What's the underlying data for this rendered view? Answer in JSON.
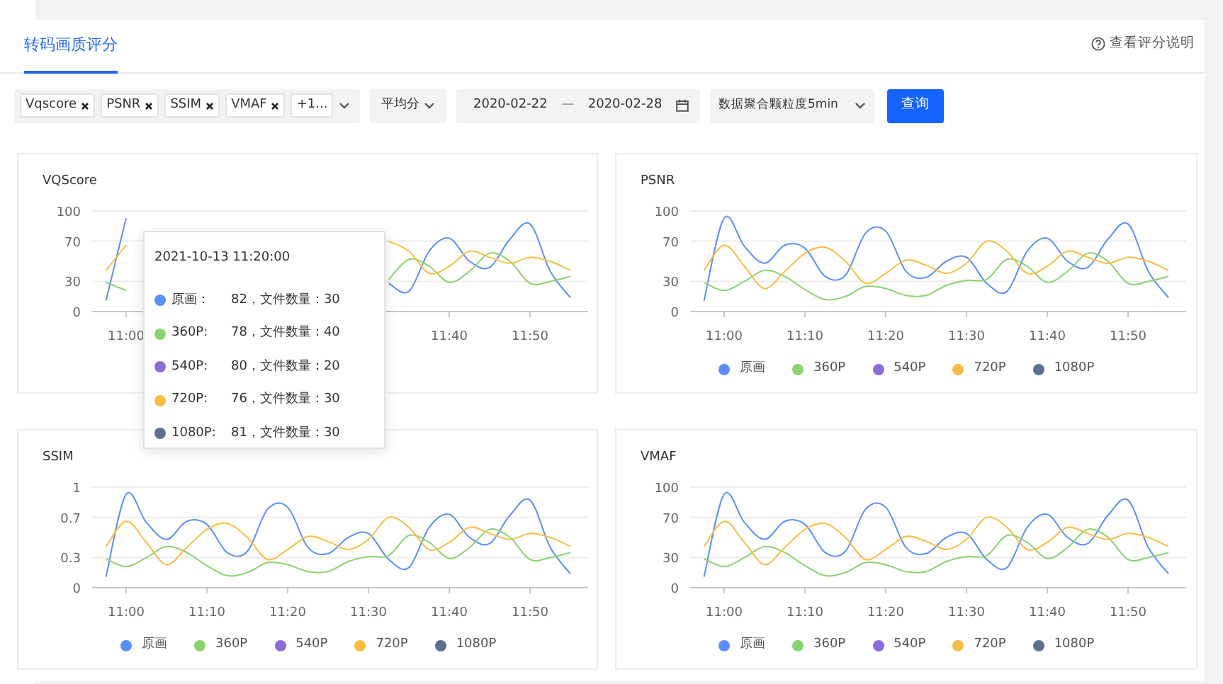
{
  "header": {
    "tab": {
      "label": "转码画质评分",
      "selected": true
    },
    "help_link": "查看评分说明"
  },
  "filters": {
    "metrics": {
      "tags": [
        "Vqscore",
        "PSNR",
        "SSIM",
        "VMAF"
      ],
      "more": "+1..."
    },
    "aggregate": "平均分",
    "date_from": "2020-02-22",
    "date_sep": "—",
    "date_to": "2020-02-28",
    "granularity": "数据聚合颗粒度5min",
    "query_button": "查询"
  },
  "panels": [
    {
      "chart_data": {
        "type": "line",
        "title": "VQScore",
        "categories": [
          null,
          "11:00",
          null,
          null,
          null,
          null,
          null,
          null,
          null,
          null,
          null,
          null,
          null,
          null,
          null,
          null,
          null,
          "11:40",
          null,
          null,
          null,
          "11:50",
          null,
          null
        ],
        "ylim": [
          0,
          100
        ],
        "yticks": [
          0,
          30,
          70,
          100
        ],
        "series": [
          {
            "color": "#5b8ff9",
            "values": [
              11,
              93,
              null,
              null,
              null,
              null,
              null,
              null,
              null,
              null,
              null,
              null,
              null,
              null,
              28,
              20,
              60,
              73,
              50,
              44,
              72,
              87,
              40,
              14
            ]
          },
          {
            "color": "#8ad36f",
            "values": [
              29,
              21,
              null,
              null,
              null,
              null,
              null,
              null,
              null,
              null,
              null,
              null,
              null,
              null,
              32,
              52,
              45,
              29,
              40,
              58,
              50,
              28,
              30,
              35
            ]
          },
          {
            "color": "#f6bd45",
            "values": [
              41,
              66,
              null,
              null,
              null,
              null,
              null,
              null,
              null,
              null,
              null,
              null,
              null,
              null,
              70,
              60,
              38,
              45,
              60,
              54,
              48,
              54,
              50,
              41
            ]
          }
        ]
      },
      "tooltip": {
        "title": "2021-10-13 11:20:00",
        "rows": [
          {
            "label": "原画：",
            "value": "82，文件数量：30",
            "color": "#5b8ff9"
          },
          {
            "label": "360P:",
            "value": "78，文件数量：40",
            "color": "#8ad36f"
          },
          {
            "label": "540P:",
            "value": "80，文件数量：20",
            "color": "#8e6bd8"
          },
          {
            "label": "720P:",
            "value": "76，文件数量：30",
            "color": "#f6bd45"
          },
          {
            "label": "1080P:",
            "value": "81，文件数量：30",
            "color": "#5d7092"
          }
        ]
      }
    },
    {
      "chart_data": {
        "type": "line",
        "title": "PSNR",
        "categories": [
          null,
          "11:00",
          null,
          null,
          null,
          "11:10",
          null,
          null,
          null,
          "11:20",
          null,
          null,
          null,
          "11:30",
          null,
          null,
          null,
          "11:40",
          null,
          null,
          null,
          "11:50",
          null,
          null
        ],
        "ylim": [
          0,
          100
        ],
        "yticks": [
          0,
          30,
          70,
          100
        ],
        "series": [
          {
            "name": "原画",
            "color": "#5b8ff9",
            "values": [
              11,
              93,
              65,
              48,
              66,
              63,
              35,
              36,
              78,
              80,
              40,
              34,
              50,
              54,
              28,
              20,
              60,
              73,
              50,
              44,
              72,
              87,
              40,
              14
            ]
          },
          {
            "name": "360P",
            "color": "#8ad36f",
            "values": [
              29,
              21,
              30,
              41,
              35,
              22,
              12,
              15,
              25,
              23,
              16,
              16,
              26,
              31,
              32,
              52,
              45,
              29,
              40,
              58,
              50,
              28,
              30,
              35
            ]
          },
          {
            "name": "540P",
            "color": "#8e6bd8",
            "values": [
              null,
              null,
              null,
              null,
              null,
              null,
              null,
              null,
              null,
              null,
              null,
              null,
              null,
              null,
              null,
              null,
              null,
              null,
              null,
              null,
              null,
              null,
              null,
              null
            ]
          },
          {
            "name": "720P",
            "color": "#f6bd45",
            "values": [
              41,
              66,
              45,
              23,
              40,
              58,
              64,
              50,
              28,
              38,
              51,
              46,
              38,
              48,
              70,
              60,
              38,
              45,
              60,
              54,
              48,
              54,
              50,
              41
            ]
          },
          {
            "name": "1080P",
            "color": "#5d7092",
            "values": [
              null,
              null,
              null,
              null,
              null,
              null,
              null,
              null,
              null,
              null,
              null,
              null,
              null,
              null,
              null,
              null,
              null,
              null,
              null,
              null,
              null,
              null,
              null,
              null
            ]
          }
        ]
      }
    },
    {
      "chart_data": {
        "type": "line",
        "title": "SSIM",
        "categories": [
          null,
          "11:00",
          null,
          null,
          null,
          "11:10",
          null,
          null,
          null,
          "11:20",
          null,
          null,
          null,
          "11:30",
          null,
          null,
          null,
          "11:40",
          null,
          null,
          null,
          "11:50",
          null,
          null
        ],
        "ylim": [
          0,
          1
        ],
        "yticks": [
          0,
          0.3,
          0.7,
          1
        ],
        "series": [
          {
            "name": "原画",
            "color": "#5b8ff9",
            "values": [
              0.11,
              0.93,
              0.65,
              0.48,
              0.66,
              0.63,
              0.35,
              0.36,
              0.78,
              0.8,
              0.4,
              0.34,
              0.5,
              0.54,
              0.28,
              0.2,
              0.6,
              0.73,
              0.5,
              0.44,
              0.72,
              0.87,
              0.4,
              0.14
            ]
          },
          {
            "name": "360P",
            "color": "#8ad36f",
            "values": [
              0.29,
              0.21,
              0.3,
              0.41,
              0.35,
              0.22,
              0.12,
              0.15,
              0.25,
              0.23,
              0.16,
              0.16,
              0.26,
              0.31,
              0.32,
              0.52,
              0.45,
              0.29,
              0.4,
              0.58,
              0.5,
              0.28,
              0.3,
              0.35
            ]
          },
          {
            "name": "540P",
            "color": "#8e6bd8",
            "values": [
              null,
              null,
              null,
              null,
              null,
              null,
              null,
              null,
              null,
              null,
              null,
              null,
              null,
              null,
              null,
              null,
              null,
              null,
              null,
              null,
              null,
              null,
              null,
              null
            ]
          },
          {
            "name": "720P",
            "color": "#f6bd45",
            "values": [
              0.41,
              0.66,
              0.45,
              0.23,
              0.4,
              0.58,
              0.64,
              0.5,
              0.28,
              0.38,
              0.51,
              0.46,
              0.38,
              0.48,
              0.7,
              0.6,
              0.38,
              0.45,
              0.6,
              0.54,
              0.48,
              0.54,
              0.5,
              0.41
            ]
          },
          {
            "name": "1080P",
            "color": "#5d7092",
            "values": [
              null,
              null,
              null,
              null,
              null,
              null,
              null,
              null,
              null,
              null,
              null,
              null,
              null,
              null,
              null,
              null,
              null,
              null,
              null,
              null,
              null,
              null,
              null,
              null
            ]
          }
        ]
      }
    },
    {
      "chart_data": {
        "type": "line",
        "title": "VMAF",
        "categories": [
          null,
          "11:00",
          null,
          null,
          null,
          "11:10",
          null,
          null,
          null,
          "11:20",
          null,
          null,
          null,
          "11:30",
          null,
          null,
          null,
          "11:40",
          null,
          null,
          null,
          "11:50",
          null,
          null
        ],
        "ylim": [
          0,
          100
        ],
        "yticks": [
          0,
          30,
          70,
          100
        ],
        "series": [
          {
            "name": "原画",
            "color": "#5b8ff9",
            "values": [
              11,
              93,
              65,
              48,
              66,
              63,
              35,
              36,
              78,
              80,
              40,
              34,
              50,
              54,
              28,
              20,
              60,
              73,
              50,
              44,
              72,
              87,
              40,
              14
            ]
          },
          {
            "name": "360P",
            "color": "#8ad36f",
            "values": [
              29,
              21,
              30,
              41,
              35,
              22,
              12,
              15,
              25,
              23,
              16,
              16,
              26,
              31,
              32,
              52,
              45,
              29,
              40,
              58,
              50,
              28,
              30,
              35
            ]
          },
          {
            "name": "540P",
            "color": "#8e6bd8",
            "values": [
              null,
              null,
              null,
              null,
              null,
              null,
              null,
              null,
              null,
              null,
              null,
              null,
              null,
              null,
              null,
              null,
              null,
              null,
              null,
              null,
              null,
              null,
              null,
              null
            ]
          },
          {
            "name": "720P",
            "color": "#f6bd45",
            "values": [
              41,
              66,
              45,
              23,
              40,
              58,
              64,
              50,
              28,
              38,
              51,
              46,
              38,
              48,
              70,
              60,
              38,
              45,
              60,
              54,
              48,
              54,
              50,
              41
            ]
          },
          {
            "name": "1080P",
            "color": "#5d7092",
            "values": [
              null,
              null,
              null,
              null,
              null,
              null,
              null,
              null,
              null,
              null,
              null,
              null,
              null,
              null,
              null,
              null,
              null,
              null,
              null,
              null,
              null,
              null,
              null,
              null
            ]
          }
        ]
      }
    }
  ]
}
